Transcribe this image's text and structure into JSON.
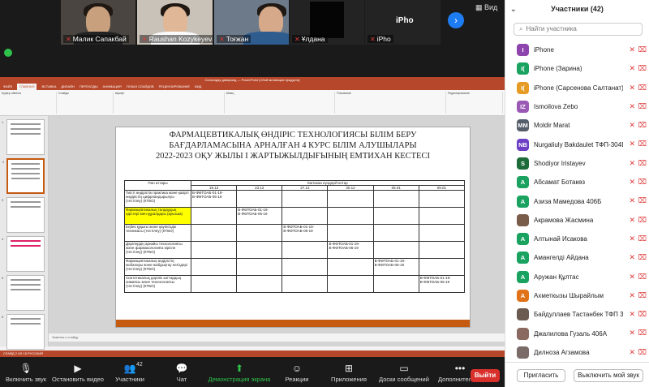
{
  "video_tiles": [
    {
      "name": "Малик Сапакбай"
    },
    {
      "name": "Raushan Kozykeyeva"
    },
    {
      "name": "Тоғжан"
    },
    {
      "name": "Ұлдана"
    },
    {
      "name": "iPho",
      "label": "iPho"
    }
  ],
  "view_label": "Вид",
  "powerpoint": {
    "window_title": "Сигналдау диваранд — PowerPoint (Сбой активации продукта)",
    "tabs": [
      "ФАЙЛ",
      "ГЛАВНАЯ",
      "ВСТАВКА",
      "ДИЗАЙН",
      "ПЕРЕХОДЫ",
      "АНИМАЦИЯ",
      "ПОКАЗ СЛАЙДОВ",
      "РЕЦЕНЗИРОВАНИЕ",
      "ВИД"
    ],
    "ribbon_groups": [
      "Буфер обмена",
      "Слайды",
      "Шрифт",
      "Абзац",
      "Рисование",
      "Редактирование"
    ],
    "notes_placeholder": "Заметки к слайду",
    "status_text": "СЛАЙД 2 ИЗ 15   РУССКИЙ",
    "slide": {
      "title_lines": [
        "ФАРМАЦЕВТИКАЛЫҚ ӨНДІРІС ТЕХНОЛОГИЯСЫ  БІЛІМ БЕРУ",
        "БАҒДАРЛАМАСЫНА АРНАЛҒАН  4 КУРС  БІЛІМ АЛУШЫЛАРЫ",
        "2022-2023 ОҚУ ЖЫЛЫ І ЖАРТЫЖЫЛДЫҒЫНЫҢ  ЕМТИХАН КЕСТЕСІ"
      ],
      "table": {
        "subject_header": "Пән аттары",
        "dates_header": "Емтихан күндері/топтар",
        "dates": [
          "19.12",
          "23.12",
          "27.12",
          "30.12",
          "06.01",
          "09.01"
        ],
        "rows": [
          {
            "subject": "Тиісті өндірістік практика және қазіргі өндірістің цифрландырылуы (тестілеу) (КТБО)",
            "col": 0,
            "groups": "В-ФӨТОАБ-01-19-\nВ-ФӨТОАБ-06-19",
            "highlight": false
          },
          {
            "subject": "Фармацевтикалық талдаудың әдістері мен құралдары (ауызша)",
            "col": 1,
            "groups": "В-ФӨТОАБ-01-19-\nВ-ФӨТОАБ-06-19",
            "highlight": true
          },
          {
            "subject": "Еңбек құқығы және қауіпсіздік техникасы (тестілеу) (КТБО)",
            "col": 2,
            "groups": "В-ФӨТОАБ-01-19-\nВ-ФӨТОАБ-06-19",
            "highlight": false
          },
          {
            "subject": "Дәрілердің арнайы технологиясы және фармакологияға кіріспе (тестілеу) (КТБО)",
            "col": 3,
            "groups": "В-ФӨТОАБ-01-19-\nВ-ФӨТОАБ-06-19",
            "highlight": false
          },
          {
            "subject": "Фармацевтикалық өндірістің жобалауы және жабдықтау негіздері (тестілеу) (КТБО)",
            "col": 4,
            "groups": "В-ФӨТОАБ-01-19-\nВ-ФӨТОАБ-06-19",
            "highlight": false
          },
          {
            "subject": "Синтетикалық дәрілік заттардың химиясы және технологиясы (тестілеу) (КТБО)",
            "col": 5,
            "groups": "В-ФӨТОАБ-01-19-\nВ-ФӨТОАБ-06-19",
            "highlight": false
          }
        ]
      }
    }
  },
  "toolbar": {
    "items": [
      {
        "label": "Включить звук",
        "icon": "mic-off-icon"
      },
      {
        "label": "Остановить видео",
        "icon": "video-icon"
      },
      {
        "label": "Участники",
        "icon": "participants-icon",
        "badge": "42"
      },
      {
        "label": "Чат",
        "icon": "chat-icon"
      },
      {
        "label": "Демонстрация экрана",
        "icon": "share-screen-icon"
      },
      {
        "label": "Реакции",
        "icon": "reactions-icon"
      },
      {
        "label": "Приложения",
        "icon": "apps-icon"
      },
      {
        "label": "Доски сообщений",
        "icon": "whiteboard-icon"
      },
      {
        "label": "Дополнительно",
        "icon": "more-icon"
      }
    ],
    "leave_label": "Выйти"
  },
  "participants_panel": {
    "title": "Участники (42)",
    "search_placeholder": "Найти участника",
    "participants": [
      {
        "initial": "I",
        "name": "iPhone",
        "color": "#8e44ad"
      },
      {
        "initial": "I(",
        "name": "iPhone (Зарина)",
        "color": "#1aa260"
      },
      {
        "initial": "I(",
        "name": "iPhone (Сарсенова Салтанат)",
        "color": "#e69c24"
      },
      {
        "initial": "IZ",
        "name": "Ismoilova Zebo",
        "color": "#9b59b6"
      },
      {
        "initial": "MM",
        "name": "Moldir Marat",
        "color": "#555e6b"
      },
      {
        "initial": "NB",
        "name": "Nurgaliuly Bakdaulet ТФП-304Б",
        "color": "#6c3fc5"
      },
      {
        "initial": "S",
        "name": "Shodiyor Iristayev",
        "color": "#1e6b3a"
      },
      {
        "initial": "A",
        "name": "Абсамат Ботакөз",
        "color": "#1aa260"
      },
      {
        "initial": "A",
        "name": "Азиза Мамедова 406Б",
        "color": "#1aa260"
      },
      {
        "initial": "",
        "name": "Акрамова Жасмина",
        "color": "#7a5c4a"
      },
      {
        "initial": "A",
        "name": "Алтынай Исакова",
        "color": "#1aa260"
      },
      {
        "initial": "A",
        "name": "Амангелді Айдана",
        "color": "#1aa260"
      },
      {
        "initial": "A",
        "name": "Аружан Құлтас",
        "color": "#1aa260"
      },
      {
        "initial": "A",
        "name": "Ахметкызы Шырайлым",
        "color": "#e0731a"
      },
      {
        "initial": "",
        "name": "Байдуллаев Тастанбек ТФП 3...",
        "color": "#6a5a50"
      },
      {
        "initial": "",
        "name": "Джалилова Гузаль 406А",
        "color": "#8a6a60"
      },
      {
        "initial": "",
        "name": "Дилноза Агзамова",
        "color": "#7a6a68"
      }
    ],
    "invite_label": "Пригласить",
    "mute_all_label": "Выключить мой звук"
  }
}
